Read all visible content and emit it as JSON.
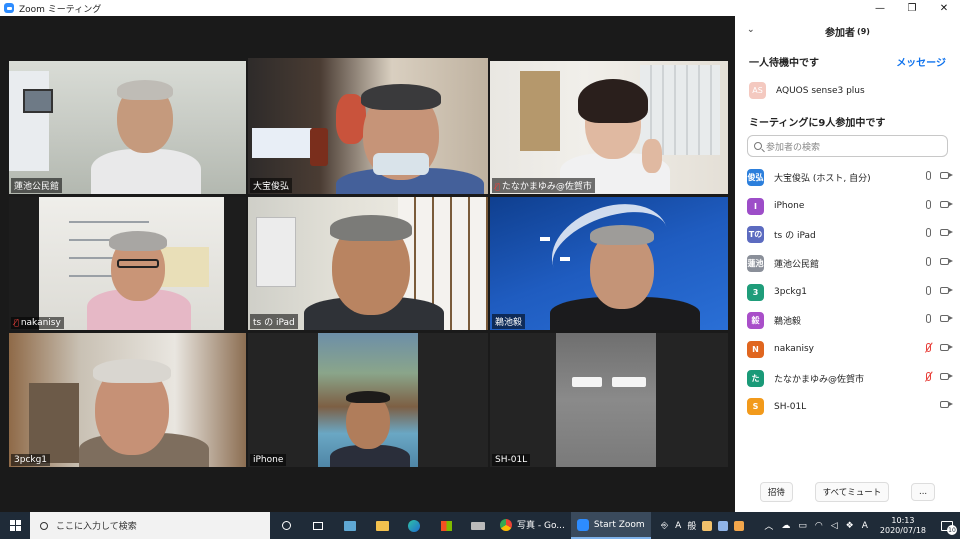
{
  "window": {
    "title": "Zoom ミーティング",
    "minimize": "—",
    "maximize": "❐",
    "close": "✕"
  },
  "tiles": [
    {
      "name": "蓮池公民館"
    },
    {
      "name": "大宝俊弘"
    },
    {
      "name": "たなかまゆみ@佐賀市",
      "muted": true
    },
    {
      "name": "nakanisy",
      "muted": true
    },
    {
      "name": "ts の iPad"
    },
    {
      "name": "鵜池毅"
    },
    {
      "name": "3pckg1"
    },
    {
      "name": "iPhone"
    },
    {
      "name": "SH-01L"
    }
  ],
  "panel": {
    "title": "参加者",
    "count": "(9)",
    "waiting_label": "一人待機中です",
    "message_link": "メッセージ",
    "waiting_person": {
      "avatar": "AS",
      "name": "AQUOS sense3 plus",
      "color": "#f4c9c0"
    },
    "in_meeting_label": "ミーティングに9人参加中です",
    "search_placeholder": "参加者の検索",
    "participants": [
      {
        "avatar": "俊弘",
        "name": "大宝俊弘 (ホスト, 自分)",
        "color": "#2c7fdc",
        "muted": false,
        "video": true
      },
      {
        "avatar": "I",
        "name": "iPhone",
        "color": "#9d4dc8",
        "muted": false,
        "video": true
      },
      {
        "avatar": "Tの",
        "name": "ts の iPad",
        "color": "#5c6bc0",
        "muted": false,
        "video": true
      },
      {
        "avatar": "蓮池",
        "name": "蓮池公民館",
        "color": "#8a8f99",
        "muted": false,
        "video": true
      },
      {
        "avatar": "3",
        "name": "3pckg1",
        "color": "#1f9d7a",
        "muted": false,
        "video": true
      },
      {
        "avatar": "毅",
        "name": "鵜池毅",
        "color": "#a94fc9",
        "muted": false,
        "video": true
      },
      {
        "avatar": "N",
        "name": "nakanisy",
        "color": "#e0661f",
        "muted": true,
        "video": true
      },
      {
        "avatar": "た",
        "name": "たなかまゆみ@佐賀市",
        "color": "#1a9a78",
        "muted": true,
        "video": true
      },
      {
        "avatar": "S",
        "name": "SH-01L",
        "color": "#f29a1b",
        "muted": null,
        "video": true
      }
    ],
    "footer": {
      "invite": "招待",
      "mute_all": "すべてミュート",
      "more": "..."
    }
  },
  "taskbar": {
    "search_text": "ここに入力して検索",
    "apps": [
      {
        "label": "写真 - Go..."
      },
      {
        "label": "Start Zoom"
      }
    ],
    "ime": "A",
    "ime2": "般",
    "tray_a": "A",
    "time": "10:13",
    "date": "2020/07/18",
    "notif_count": "10"
  }
}
